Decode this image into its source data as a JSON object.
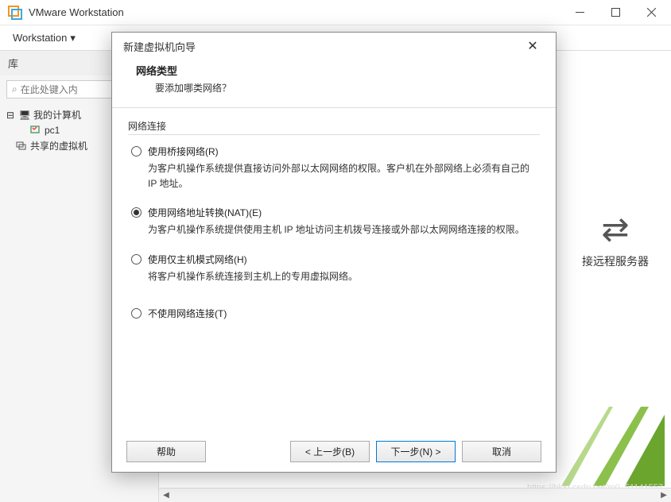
{
  "window": {
    "title": "VMware Workstation"
  },
  "menubar": {
    "workstation": "Workstation"
  },
  "sidebar": {
    "header": "库",
    "search_placeholder": "在此处键入内",
    "items": {
      "mycomputer": "我的计算机",
      "pc1": "pc1",
      "shared": "共享的虚拟机"
    }
  },
  "main": {
    "remote_text": "接远程服务器",
    "watermark": "https://blog.csdn.net/m0_51141557"
  },
  "dialog": {
    "title": "新建虚拟机向导",
    "heading": "网络类型",
    "subheading": "要添加哪类网络？",
    "fieldset": "网络连接",
    "options": {
      "bridged": {
        "label": "使用桥接网络(R)",
        "desc": "为客户机操作系统提供直接访问外部以太网网络的权限。客户机在外部网络上必须有自己的 IP 地址。"
      },
      "nat": {
        "label": "使用网络地址转换(NAT)(E)",
        "desc": "为客户机操作系统提供使用主机 IP 地址访问主机拨号连接或外部以太网网络连接的权限。"
      },
      "hostonly": {
        "label": "使用仅主机模式网络(H)",
        "desc": "将客户机操作系统连接到主机上的专用虚拟网络。"
      },
      "none": {
        "label": "不使用网络连接(T)"
      }
    },
    "buttons": {
      "help": "帮助",
      "back": "< 上一步(B)",
      "next": "下一步(N) >",
      "cancel": "取消"
    }
  }
}
